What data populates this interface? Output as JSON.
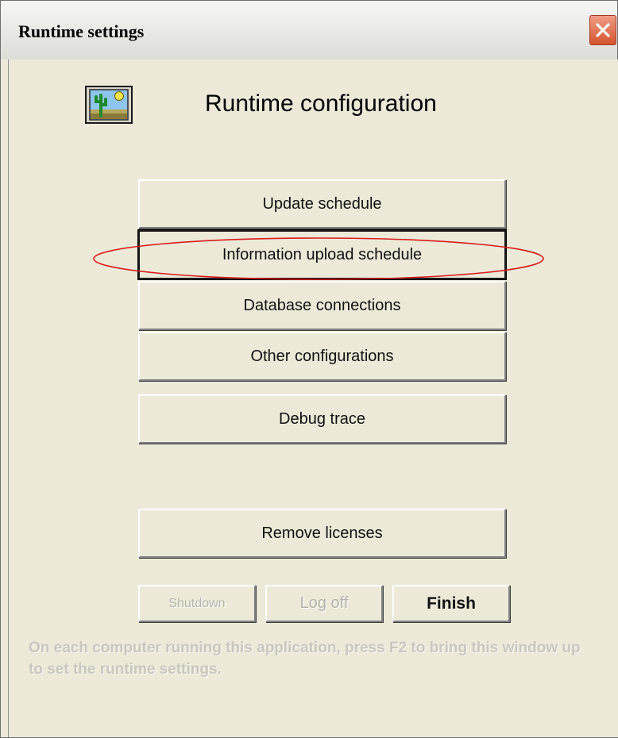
{
  "window": {
    "title": "Runtime settings"
  },
  "header": {
    "heading": "Runtime configuration",
    "icon": "cactus-desert-icon"
  },
  "buttons": {
    "update_schedule": "Update schedule",
    "information_upload_schedule": "Information upload schedule",
    "database_connections": "Database connections",
    "other_configurations": "Other configurations",
    "debug_trace": "Debug trace",
    "remove_licenses": "Remove licenses"
  },
  "footer_buttons": {
    "shutdown": "Shutdown",
    "log_off": "Log off",
    "finish": "Finish"
  },
  "note": "On each computer running this application, press F2 to bring this window up to set the runtime settings.",
  "colors": {
    "annotation": "#d81b1b",
    "close_button": "#d5542f"
  }
}
